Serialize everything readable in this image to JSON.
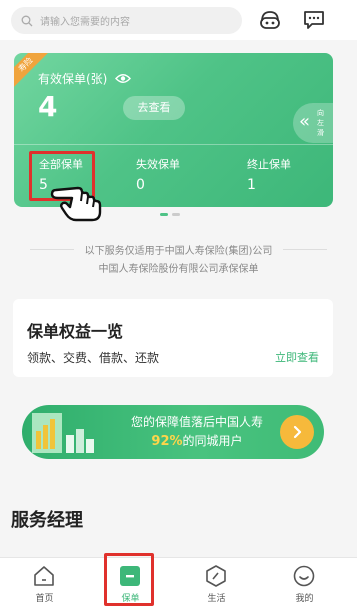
{
  "search": {
    "placeholder": "请输入您需要的内容"
  },
  "header_icons": [
    "robot-service-icon",
    "message-icon"
  ],
  "policy_card": {
    "ribbon": "寿险",
    "valid_label": "有效保单(张)",
    "valid_count": "4",
    "view_button": "去查看",
    "swipe_hint": "向左滑",
    "stats": [
      {
        "label": "全部保单",
        "value": "5"
      },
      {
        "label": "失效保单",
        "value": "0"
      },
      {
        "label": "终止保单",
        "value": "1"
      }
    ],
    "pager": {
      "pages": 2,
      "current": 1
    }
  },
  "notice": {
    "line1": "以下服务仅适用于中国人寿保险(集团)公司",
    "line2": "中国人寿保险股份有限公司承保保单"
  },
  "benefits": {
    "title": "保单权益一览",
    "items": "领款、交费、借款、还款",
    "link": "立即查看"
  },
  "banner": {
    "line1": "您的保障值落后中国人寿",
    "percent": "92%",
    "line2_suffix": "的同城用户"
  },
  "service_manager": {
    "title": "服务经理"
  },
  "tabs": [
    {
      "label": "首页",
      "icon": "home-icon",
      "active": false
    },
    {
      "label": "保单",
      "icon": "policy-icon",
      "active": true
    },
    {
      "label": "生活",
      "icon": "life-icon",
      "active": false
    },
    {
      "label": "我的",
      "icon": "profile-icon",
      "active": false
    }
  ],
  "colors": {
    "accent": "#3db779",
    "highlight": "#e0312c",
    "ribbon": "#f0a43d",
    "banner_percent": "#ffd54a"
  }
}
